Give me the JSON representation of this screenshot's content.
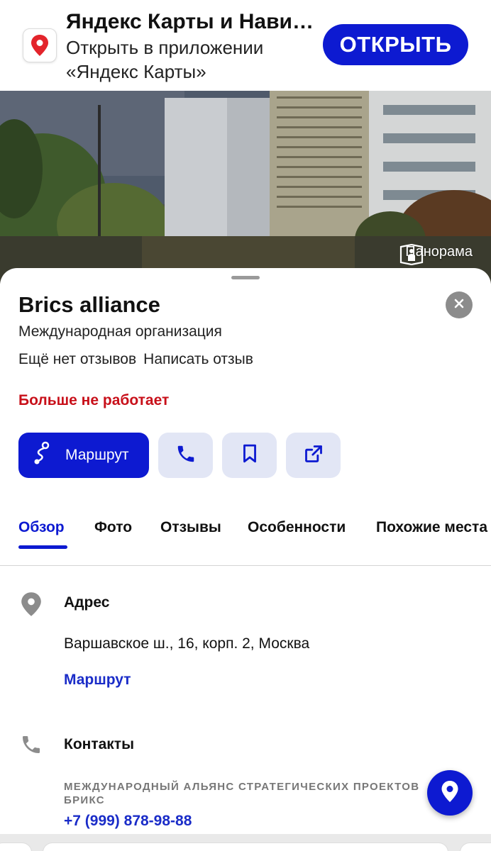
{
  "banner": {
    "title": "Яндекс Карты и Нави…",
    "subtitle": "Открыть в приложении «Яндекс Карты»",
    "open_label": "ОТКРЫТЬ",
    "icon": "yandex-maps-pin-icon"
  },
  "photo": {
    "panorama_label": "Панорама",
    "panorama_icon": "panorama-icon"
  },
  "place": {
    "name": "Brics alliance",
    "category": "Международная организация",
    "no_reviews": "Ещё нет отзывов",
    "write_review": "Написать отзыв",
    "status": "Больше не работает"
  },
  "actions": {
    "route_label": "Маршрут",
    "icons": [
      "route-icon",
      "phone-icon",
      "bookmark-icon",
      "share-icon"
    ]
  },
  "tabs": [
    {
      "label": "Обзор",
      "active": true
    },
    {
      "label": "Фото",
      "active": false
    },
    {
      "label": "Отзывы",
      "active": false
    },
    {
      "label": "Особенности",
      "active": false
    },
    {
      "label": "Похожие места",
      "active": false
    }
  ],
  "address": {
    "title": "Адрес",
    "value": "Варшавское ш., 16, корп. 2, Москва",
    "route_link": "Маршрут"
  },
  "contacts": {
    "title": "Контакты",
    "org_name": "МЕЖДУНАРОДНЫЙ АЛЬЯНС СТРАТЕГИЧЕСКИХ ПРОЕКТОВ БРИКС",
    "phone": "+7 (999) 878-98-88"
  },
  "colors": {
    "accent": "#0d1ad1",
    "link": "#1a2cc8",
    "closed": "#c8101a",
    "secondary_button": "#e2e6f5"
  }
}
